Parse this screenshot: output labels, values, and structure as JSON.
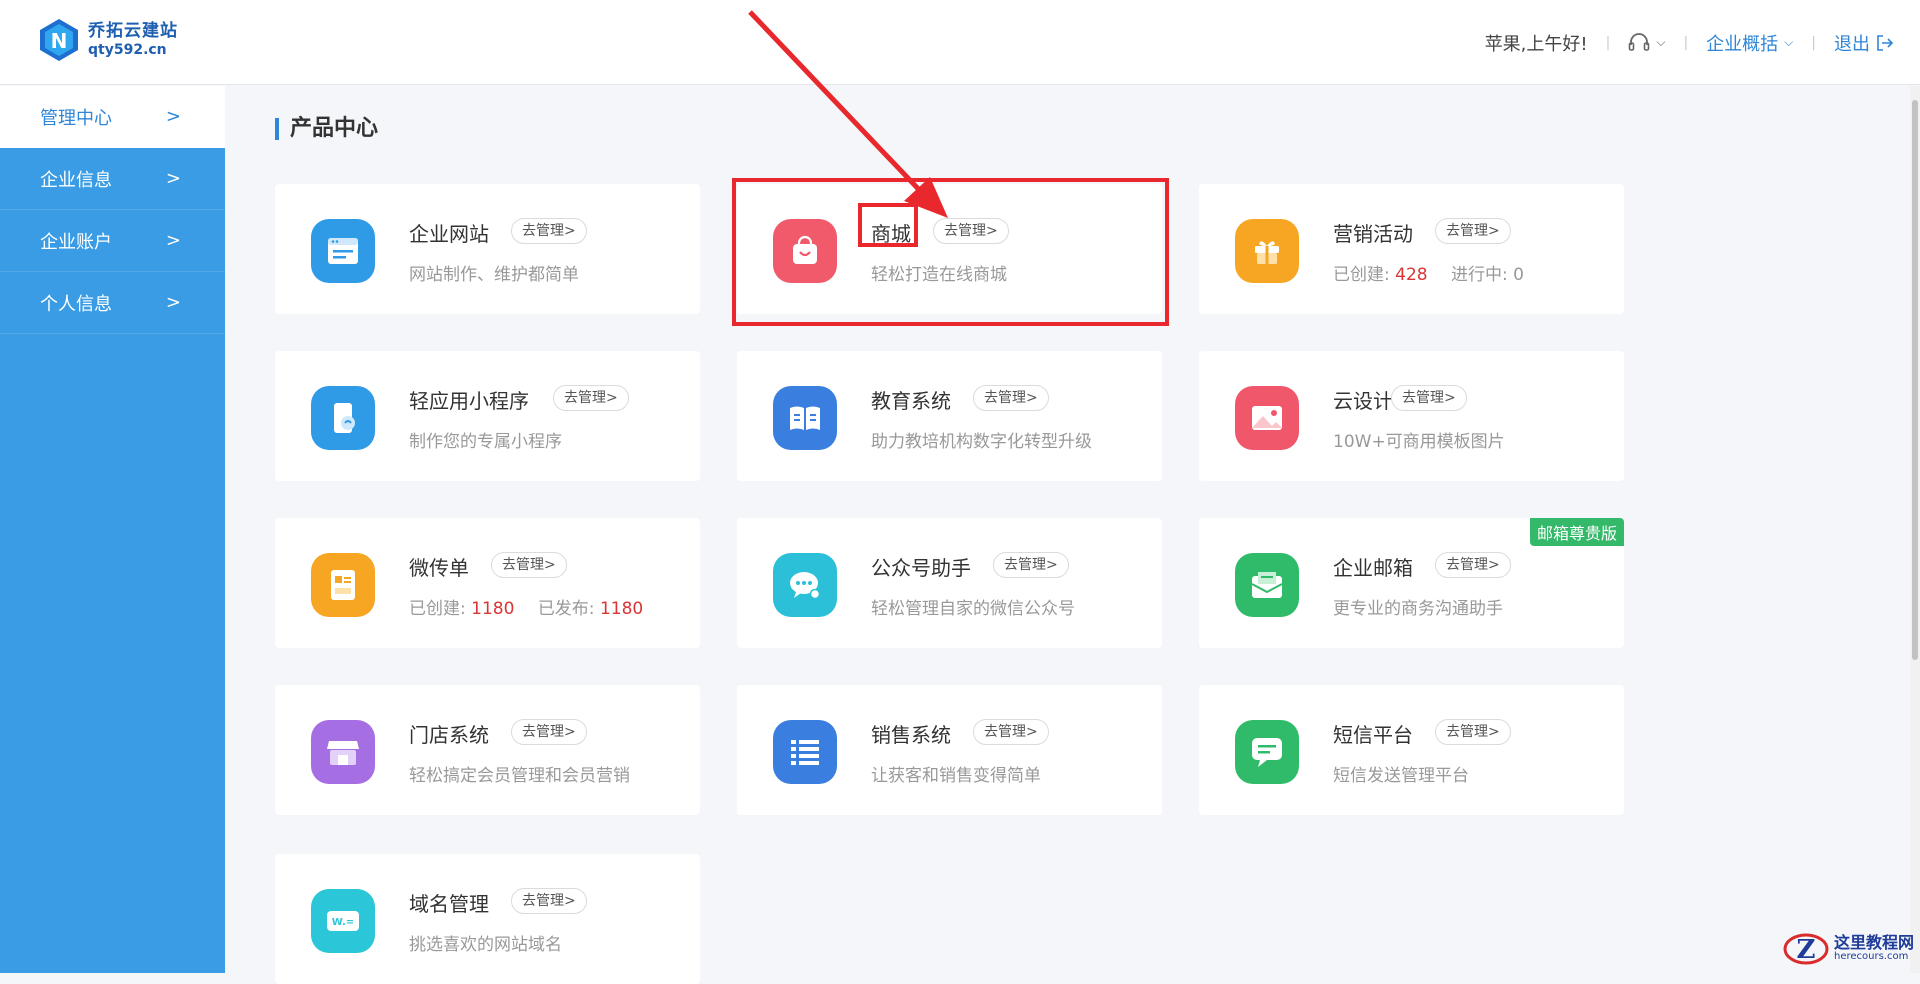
{
  "header": {
    "logo_name": "乔拓云建站",
    "logo_domain": "qty592.cn",
    "greeting": "苹果,上午好!",
    "overview_label": "企业概括",
    "logout_label": "退出"
  },
  "sidebar": {
    "items": [
      {
        "label": "管理中心",
        "active": true
      },
      {
        "label": "企业信息",
        "active": false
      },
      {
        "label": "企业账户",
        "active": false
      },
      {
        "label": "个人信息",
        "active": false
      }
    ]
  },
  "main": {
    "section_title": "产品中心",
    "manage_label": "去管理>",
    "cards": [
      {
        "title": "企业网站",
        "desc": "网站制作、维护都简单",
        "icon": "website-icon",
        "color": "#2f9ae6"
      },
      {
        "title": "商城",
        "desc": "轻松打造在线商城",
        "icon": "shopping-bag-icon",
        "color": "#f05a6a"
      },
      {
        "title": "营销活动",
        "desc_prefix_a": "已创建:",
        "value_a": "428",
        "desc_prefix_b": "进行中:",
        "value_b": "0",
        "icon": "gift-icon",
        "color": "#f7a623"
      },
      {
        "title": "轻应用小程序",
        "desc": "制作您的专属小程序",
        "icon": "mini-program-icon",
        "color": "#2f9ae6"
      },
      {
        "title": "教育系统",
        "desc": "助力教培机构数字化转型升级",
        "icon": "book-icon",
        "color": "#3a7fe0"
      },
      {
        "title": "云设计",
        "desc": "10W+可商用模板图片",
        "icon": "image-icon",
        "color": "#f0576a"
      },
      {
        "title": "微传单",
        "desc_prefix_a": "已创建:",
        "value_a": "1180",
        "desc_prefix_b": "已发布:",
        "value_b": "1180",
        "icon": "flyer-icon",
        "color": "#f7a623"
      },
      {
        "title": "公众号助手",
        "desc": "轻松管理自家的微信公众号",
        "icon": "wechat-icon",
        "color": "#2bc0d8"
      },
      {
        "title": "企业邮箱",
        "desc": "更专业的商务沟通助手",
        "icon": "mail-icon",
        "color": "#2fbb6a",
        "badge": "邮箱尊贵版"
      },
      {
        "title": "门店系统",
        "desc": "轻松搞定会员管理和会员营销",
        "icon": "store-icon",
        "color": "#a66ee3"
      },
      {
        "title": "销售系统",
        "desc": "让获客和销售变得简单",
        "icon": "list-icon",
        "color": "#3a7fe0"
      },
      {
        "title": "短信平台",
        "desc": "短信发送管理平台",
        "icon": "sms-icon",
        "color": "#2fbb6a"
      },
      {
        "title": "域名管理",
        "desc": "挑选喜欢的网站域名",
        "icon": "domain-icon",
        "color": "#2bc6d8"
      }
    ]
  },
  "watermark": {
    "cn": "这里教程网",
    "en": "herecours.com"
  }
}
